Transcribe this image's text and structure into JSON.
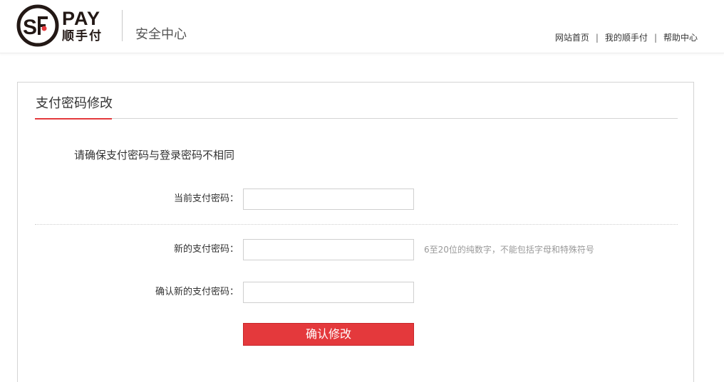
{
  "header": {
    "logo_text_en": "PAY",
    "logo_text_cn": "顺手付",
    "title": "安全中心",
    "nav": [
      {
        "label": "网站首页"
      },
      {
        "label": "我的顺手付"
      },
      {
        "label": "帮助中心"
      }
    ],
    "nav_separator": "|"
  },
  "panel": {
    "title": "支付密码修改",
    "notice": "请确保支付密码与登录密码不相同",
    "fields": {
      "current": {
        "label": "当前支付密码：",
        "value": ""
      },
      "new": {
        "label": "新的支付密码：",
        "value": "",
        "hint": "6至20位的纯数字，不能包括字母和特殊符号"
      },
      "confirm": {
        "label": "确认新的支付密码：",
        "value": ""
      }
    },
    "submit_label": "确认修改"
  },
  "colors": {
    "accent": "#e4393c",
    "logo_dark": "#231815"
  },
  "icons": {
    "logo": "sf-logo-icon"
  }
}
